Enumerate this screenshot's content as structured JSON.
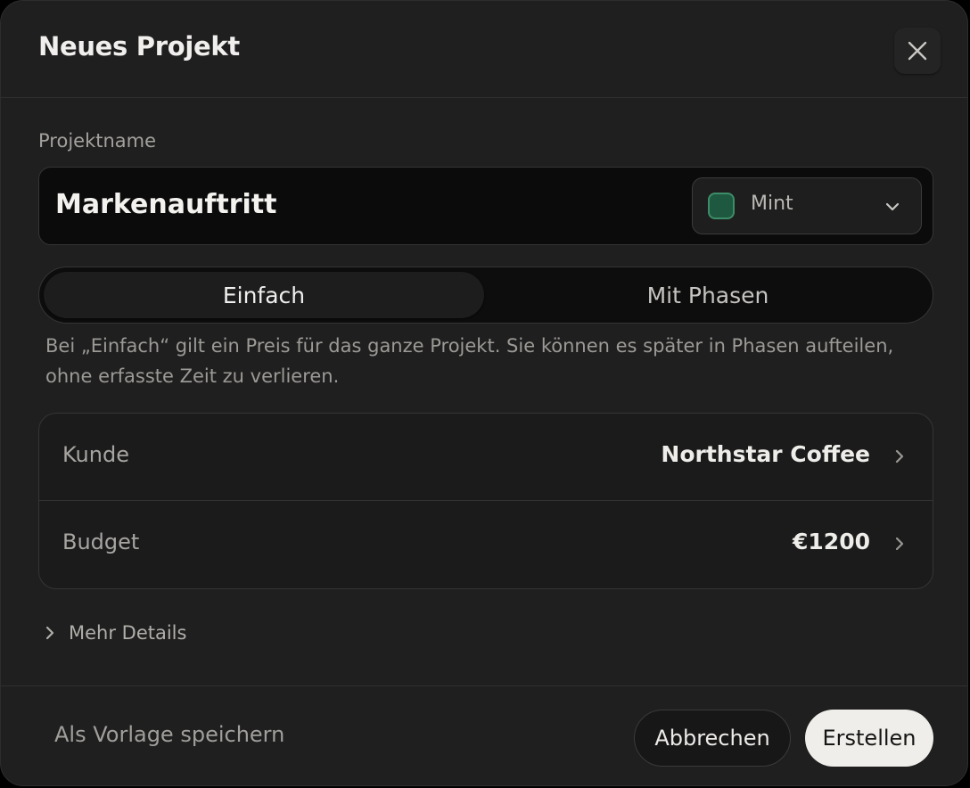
{
  "dialog": {
    "title": "Neues Projekt"
  },
  "project_name": {
    "label": "Projektname",
    "value": "Markenauftritt"
  },
  "color_select": {
    "selected": "Mint",
    "swatch_color": "#1f5840"
  },
  "mode_toggle": {
    "options": [
      "Einfach",
      "Mit Phasen"
    ],
    "selected": "Einfach"
  },
  "hint": "Bei „Einfach“ gilt ein Preis für das ganze Projekt. Sie können es später in Phasen aufteilen, ohne erfasste Zeit zu verlieren.",
  "details": [
    {
      "label": "Kunde",
      "value": "Northstar Coffee"
    },
    {
      "label": "Budget",
      "value": "€1200"
    }
  ],
  "more_details": {
    "label": "Mehr Details"
  },
  "footer": {
    "save_template_label": "Als Vorlage speichern",
    "cancel_label": "Abbrechen",
    "create_label": "Erstellen"
  },
  "icons": {
    "close": "close-icon",
    "dropdown": "chevron-down-icon",
    "row_arrow": "chevron-right-icon",
    "expand": "chevron-right-icon"
  }
}
